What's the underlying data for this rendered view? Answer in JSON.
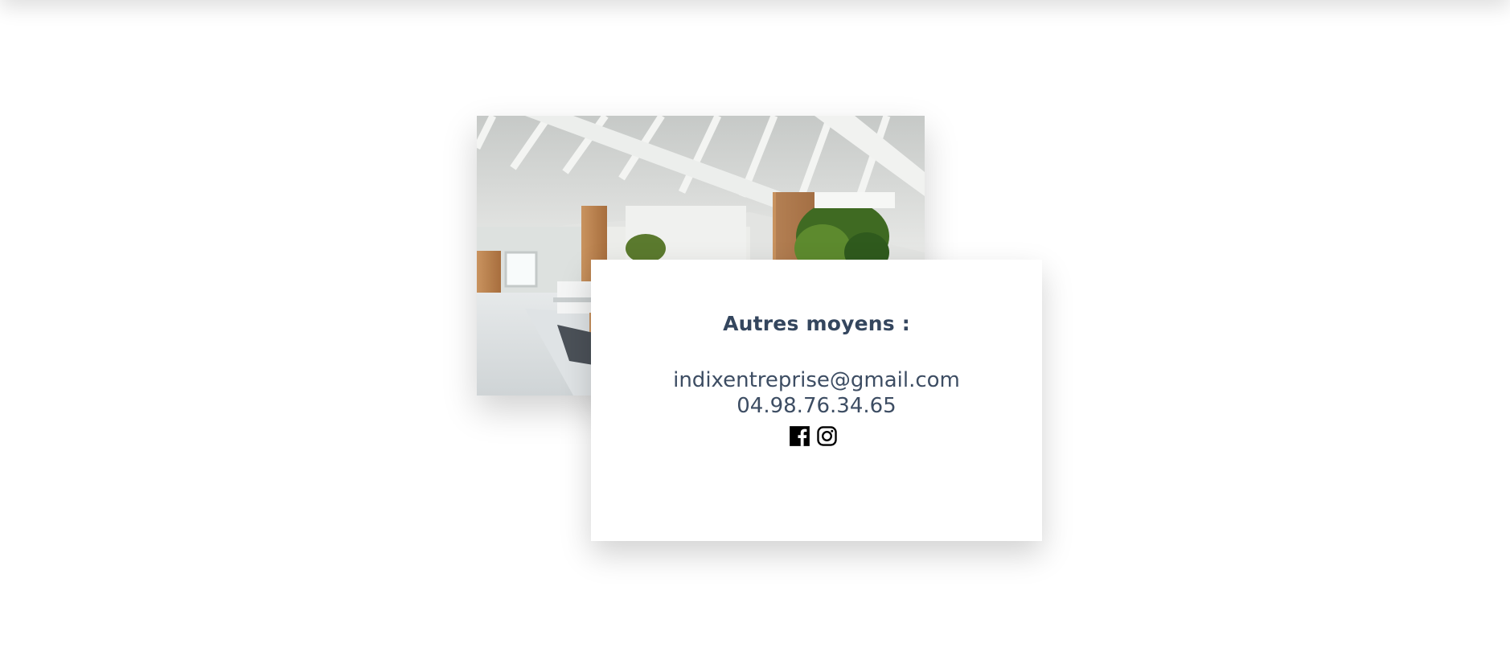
{
  "contact": {
    "heading": "Autres moyens :",
    "email": "indixentreprise@gmail.com",
    "phone": "04.98.76.34.65",
    "social": [
      {
        "icon": "facebook-icon"
      },
      {
        "icon": "instagram-icon"
      }
    ]
  },
  "colors": {
    "heading": "#34465e",
    "text": "#3d4d63",
    "icon": "#000000",
    "background": "#ffffff"
  }
}
